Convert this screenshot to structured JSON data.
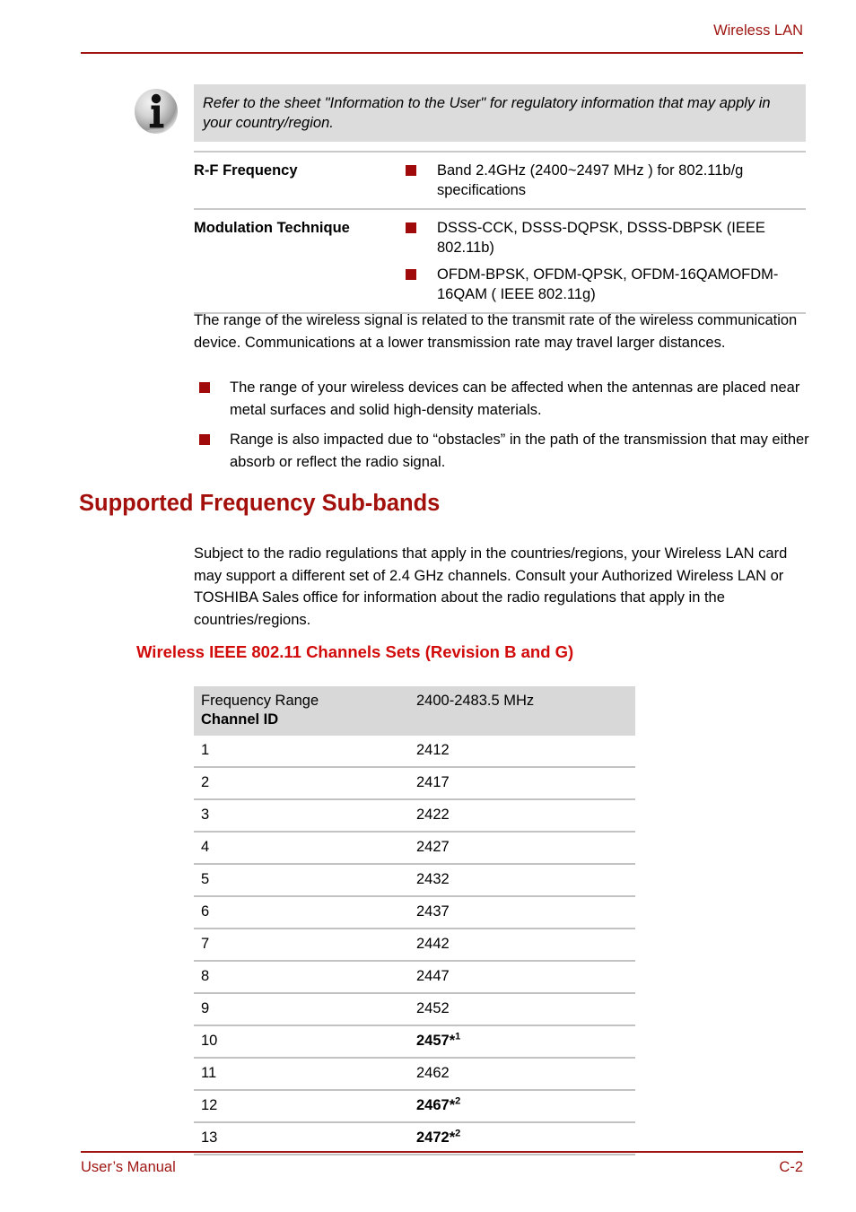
{
  "header": {
    "title": "Wireless LAN"
  },
  "note": {
    "icon": "info-icon",
    "text": "Refer to the sheet \"Information to the User\" for regulatory information that may apply in your country/region."
  },
  "spec_table": {
    "rows": [
      {
        "label": "R-F Frequency",
        "items": [
          "Band 2.4GHz (2400~2497 MHz ) for 802.11b/g specifications"
        ]
      },
      {
        "label": "Modulation Technique",
        "items": [
          "DSSS-CCK, DSSS-DQPSK, DSSS-DBPSK (IEEE 802.11b)",
          "OFDM-BPSK, OFDM-QPSK, OFDM-16QAMOFDM-16QAM ( IEEE 802.11g)"
        ]
      }
    ]
  },
  "range_paragraph": "The range of the wireless signal is related to the transmit rate of the wireless communication device. Communications at a lower transmission rate may travel larger distances.",
  "range_bullets": [
    "The range of your wireless devices can be affected when the antennas are placed near metal surfaces and solid high-density materials.",
    "Range is also impacted due to “obstacles” in the path of the transmission that may either absorb or reflect the radio signal."
  ],
  "section": {
    "heading": "Supported Frequency Sub-bands",
    "paragraph": "Subject to the radio regulations that apply in the countries/regions, your Wireless LAN card may support a different set of 2.4 GHz channels. Consult your Authorized Wireless LAN or TOSHIBA Sales office for information about the radio regulations that apply in the countries/regions.",
    "subheading": "Wireless IEEE 802.11 Channels Sets (Revision B and G)"
  },
  "channel_table": {
    "header": {
      "col_a_line1": "Frequency Range",
      "col_a_line2": "Channel ID",
      "col_b": "2400-2483.5 MHz"
    },
    "rows": [
      {
        "id": "1",
        "freq": "2412",
        "bold": false,
        "sup": ""
      },
      {
        "id": "2",
        "freq": "2417",
        "bold": false,
        "sup": ""
      },
      {
        "id": "3",
        "freq": "2422",
        "bold": false,
        "sup": ""
      },
      {
        "id": "4",
        "freq": "2427",
        "bold": false,
        "sup": ""
      },
      {
        "id": "5",
        "freq": "2432",
        "bold": false,
        "sup": ""
      },
      {
        "id": "6",
        "freq": "2437",
        "bold": false,
        "sup": ""
      },
      {
        "id": "7",
        "freq": "2442",
        "bold": false,
        "sup": ""
      },
      {
        "id": "8",
        "freq": "2447",
        "bold": false,
        "sup": ""
      },
      {
        "id": "9",
        "freq": "2452",
        "bold": false,
        "sup": ""
      },
      {
        "id": "10",
        "freq": "2457*",
        "bold": true,
        "sup": "1"
      },
      {
        "id": "11",
        "freq": "2462",
        "bold": false,
        "sup": ""
      },
      {
        "id": "12",
        "freq": "2467*",
        "bold": true,
        "sup": "2"
      },
      {
        "id": "13",
        "freq": "2472*",
        "bold": true,
        "sup": "2"
      }
    ]
  },
  "footer": {
    "left": "User’s Manual",
    "right": "C-2"
  },
  "colors": {
    "accent_red": "#9E1511",
    "heading_red": "#A30F0B",
    "subheading_red": "#D10A0A",
    "bullet_square": "#A00A0A",
    "note_bg": "#DCDCDC",
    "table_header_bg": "#D8D8D8",
    "rule_gray": "#C2C2C2"
  }
}
